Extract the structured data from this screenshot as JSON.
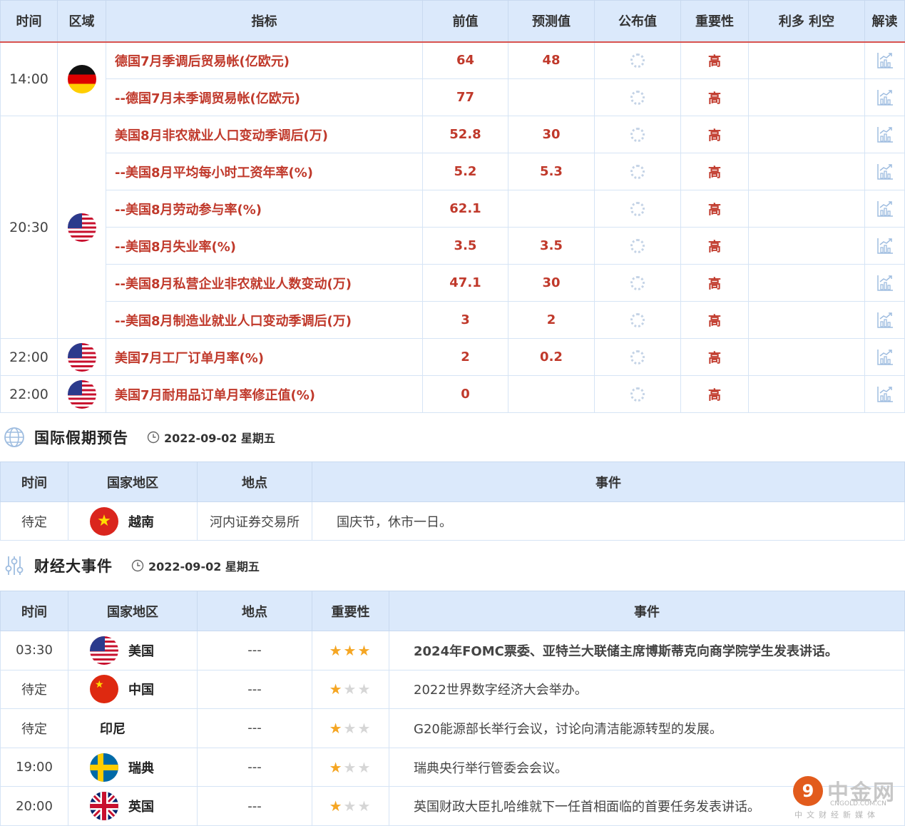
{
  "econ": {
    "headers": {
      "time": "时间",
      "region": "区域",
      "indicator": "指标",
      "previous": "前值",
      "forecast": "预测值",
      "actual": "公布值",
      "importance": "重要性",
      "effect": "利多 利空",
      "interpret": "解读"
    },
    "time_groups": [
      "14:00",
      "20:30",
      "22:00",
      "22:00"
    ],
    "rows": [
      {
        "indicator": "德国7月季调后贸易帐(亿欧元)",
        "previous": "64",
        "forecast": "48",
        "importance": "高"
      },
      {
        "indicator": "--德国7月未季调贸易帐(亿欧元)",
        "previous": "77",
        "forecast": "",
        "importance": "高"
      },
      {
        "indicator": "美国8月非农就业人口变动季调后(万)",
        "previous": "52.8",
        "forecast": "30",
        "importance": "高"
      },
      {
        "indicator": "--美国8月平均每小时工资年率(%)",
        "previous": "5.2",
        "forecast": "5.3",
        "importance": "高"
      },
      {
        "indicator": "--美国8月劳动参与率(%)",
        "previous": "62.1",
        "forecast": "",
        "importance": "高"
      },
      {
        "indicator": "--美国8月失业率(%)",
        "previous": "3.5",
        "forecast": "3.5",
        "importance": "高"
      },
      {
        "indicator": "--美国8月私营企业非农就业人数变动(万)",
        "previous": "47.1",
        "forecast": "30",
        "importance": "高"
      },
      {
        "indicator": "--美国8月制造业就业人口变动季调后(万)",
        "previous": "3",
        "forecast": "2",
        "importance": "高"
      },
      {
        "indicator": "美国7月工厂订单月率(%)",
        "previous": "2",
        "forecast": "0.2",
        "importance": "高"
      },
      {
        "indicator": "美国7月耐用品订单月率修正值(%)",
        "previous": "0",
        "forecast": "",
        "importance": "高"
      }
    ]
  },
  "holiday_section": {
    "title": "国际假期预告",
    "date": "2022-09-02 星期五",
    "headers": {
      "time": "时间",
      "region": "国家地区",
      "place": "地点",
      "event": "事件"
    },
    "rows": [
      {
        "time": "待定",
        "region": "越南",
        "place": "河内证券交易所",
        "event": "国庆节，休市一日。"
      }
    ]
  },
  "events_section": {
    "title": "财经大事件",
    "date": "2022-09-02 星期五",
    "headers": {
      "time": "时间",
      "region": "国家地区",
      "place": "地点",
      "importance": "重要性",
      "event": "事件"
    },
    "rows": [
      {
        "time": "03:30",
        "region": "美国",
        "place": "---",
        "stars": 3,
        "event": "2024年FOMC票委、亚特兰大联储主席博斯蒂克向商学院学生发表讲话。"
      },
      {
        "time": "待定",
        "region": "中国",
        "place": "---",
        "stars": 1,
        "event": "2022世界数字经济大会举办。"
      },
      {
        "time": "待定",
        "region": "印尼",
        "place": "---",
        "stars": 1,
        "event": "G20能源部长举行会议，讨论向清洁能源转型的发展。"
      },
      {
        "time": "19:00",
        "region": "瑞典",
        "place": "---",
        "stars": 1,
        "event": "瑞典央行举行管委会会议。"
      },
      {
        "time": "20:00",
        "region": "英国",
        "place": "---",
        "stars": 1,
        "event": "英国财政大臣扎哈维就下一任首相面临的首要任务发表讲话。"
      }
    ]
  },
  "watermark": {
    "name": "中金网",
    "url": "CNGOLD.COM.CN",
    "sub": "中文财经新媒体",
    "logo_char": "9"
  },
  "colors": {
    "accent_red": "#c0392b",
    "header_bg": "#dbe9fb",
    "border": "#d6e4f5",
    "star": "#f5a623"
  },
  "icons": {
    "actual_pending": "loading-spinner-icon",
    "interpret": "chart-analysis-icon",
    "holiday": "globe-icon",
    "events": "sliders-icon",
    "date": "clock-icon"
  }
}
